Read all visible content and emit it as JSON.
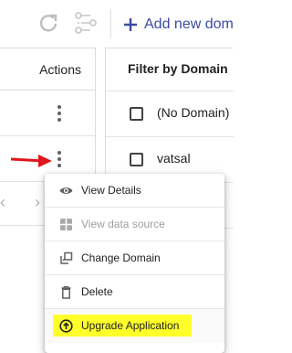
{
  "toolbar": {
    "refresh_icon": "refresh-icon",
    "workflow_icon": "workflow-icon",
    "add_domain_label": "Add new dom"
  },
  "table": {
    "actions_header": "Actions",
    "rows": [
      {
        "menu_icon": "more-vert-icon"
      },
      {
        "menu_icon": "more-vert-icon"
      }
    ],
    "pager": {
      "prev": "‹",
      "next": "›"
    }
  },
  "filter": {
    "title": "Filter by Domain",
    "options": [
      {
        "label": "(No Domain)",
        "checked": false
      },
      {
        "label": "vatsal",
        "checked": false
      },
      {
        "label": "",
        "checked": false
      },
      {
        "label": "",
        "checked": false
      }
    ]
  },
  "context_menu": {
    "items": [
      {
        "label": "View Details",
        "icon": "eye-icon",
        "enabled": true
      },
      {
        "label": "View data source",
        "icon": "grid-icon",
        "enabled": false
      },
      {
        "label": "Change Domain",
        "icon": "change-domain-icon",
        "enabled": true
      },
      {
        "label": "Delete",
        "icon": "trash-icon",
        "enabled": true
      },
      {
        "label": "Upgrade Application",
        "icon": "upgrade-icon",
        "enabled": true,
        "highlighted": true
      }
    ]
  },
  "colors": {
    "accent": "#3b4ba3",
    "annotation_arrow": "#e0161b",
    "highlight": "#ffff2a"
  }
}
